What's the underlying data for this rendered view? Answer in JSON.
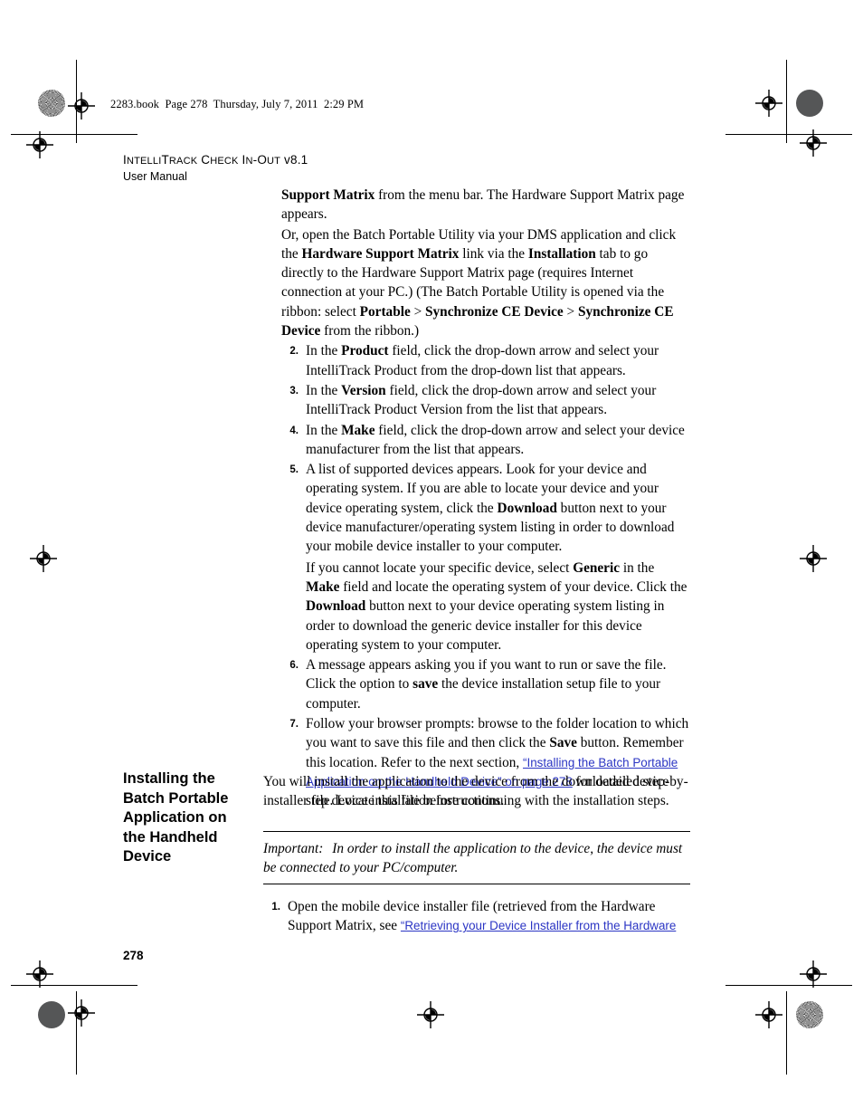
{
  "file_stamp": "2283.book  Page 278  Thursday, July 7, 2011  2:29 PM",
  "running_head": {
    "line1_a": "I",
    "line1_b": "NTELLI",
    "line1_c": "T",
    "line1_d": "RACK",
    "line1_e": " C",
    "line1_f": "HECK",
    "line1_g": " I",
    "line1_h": "N",
    "line1_i": "-O",
    "line1_j": "UT",
    "line1_k": " v8.1",
    "line2": "User Manual"
  },
  "page_number": "278",
  "content": {
    "p1_bold": "Support Matrix",
    "p1_rest": " from the menu bar. The Hardware Support Matrix page appears.",
    "p2_a": "Or, open the Batch Portable Utility via your DMS application and click the ",
    "p2_b": "Hardware Support Matrix",
    "p2_c": " link via the ",
    "p2_d": "Installation",
    "p2_e": " tab to go directly to the Hardware Support Matrix page (requires Internet connection at your PC.) (The Batch Portable Utility is opened via the ribbon: select ",
    "p2_f": "Portable",
    "p2_g": " > ",
    "p2_h": "Synchronize CE Device",
    "p2_i": " > ",
    "p2_j": "Synchronize CE Device",
    "p2_k": " from the ribbon.)",
    "item2_num": "2.",
    "item2_a": "In the ",
    "item2_b": "Product",
    "item2_c": " field, click the drop-down arrow and select your IntelliTrack Product from the drop-down list that appears.",
    "item3_num": "3.",
    "item3_a": "In the ",
    "item3_b": "Version",
    "item3_c": " field, click the drop-down arrow and select your IntelliTrack Product Version from the list that appears.",
    "item4_num": "4.",
    "item4_a": "In the ",
    "item4_b": "Make",
    "item4_c": " field, click the drop-down arrow and select your device manufacturer from the list that appears.",
    "item5_num": "5.",
    "item5_a": "A list of supported devices appears. Look for your device and operating system. If you are able to locate your device and your device operating system, click the ",
    "item5_b": "Download",
    "item5_c": " button next to your device manufacturer/operating system listing in order to download your mobile device installer to your computer.",
    "item5_sub_a": "If you cannot locate your specific device, select ",
    "item5_sub_b": "Generic",
    "item5_sub_c": " in the ",
    "item5_sub_d": "Make",
    "item5_sub_e": " field and locate the operating system of your device. Click the ",
    "item5_sub_f": "Download",
    "item5_sub_g": " button next to your device operating system listing in order to download the generic device installer for this device operating system to your computer.",
    "item6_num": "6.",
    "item6_a": "A message appears asking you if you want to run or save the file. Click the option to ",
    "item6_b": "save",
    "item6_c": " the device installation setup file to your computer.",
    "item7_num": "7.",
    "item7_a": "Follow your browser prompts: browse to the folder location to which you want to save this file and then click the ",
    "item7_b": "Save",
    "item7_c": " button. Remember this location. Refer to the next section, ",
    "item7_link": "“Installing the Batch Portable Application on the Handheld Device” on page 278",
    "item7_d": " for detailed step-by-step device installation instructions."
  },
  "section": {
    "heading": "Installing the Batch Portable Application on the Handheld Device",
    "intro": "You will install the application to the device from the downloaded device installer file. Locate this file before continuing with the installation steps.",
    "note_label": "Important:",
    "note_text": "In order to install the application to the device, the device must be connected to your PC/computer.",
    "item1_num": "1.",
    "item1_a": "Open the mobile device installer file (retrieved from the Hardware Support Matrix, see ",
    "item1_link": "“Retrieving your Device Installer from the Hardware "
  },
  "colors": {
    "link": "#2b35c4",
    "text": "#000000",
    "patch_solid": "#555657"
  }
}
